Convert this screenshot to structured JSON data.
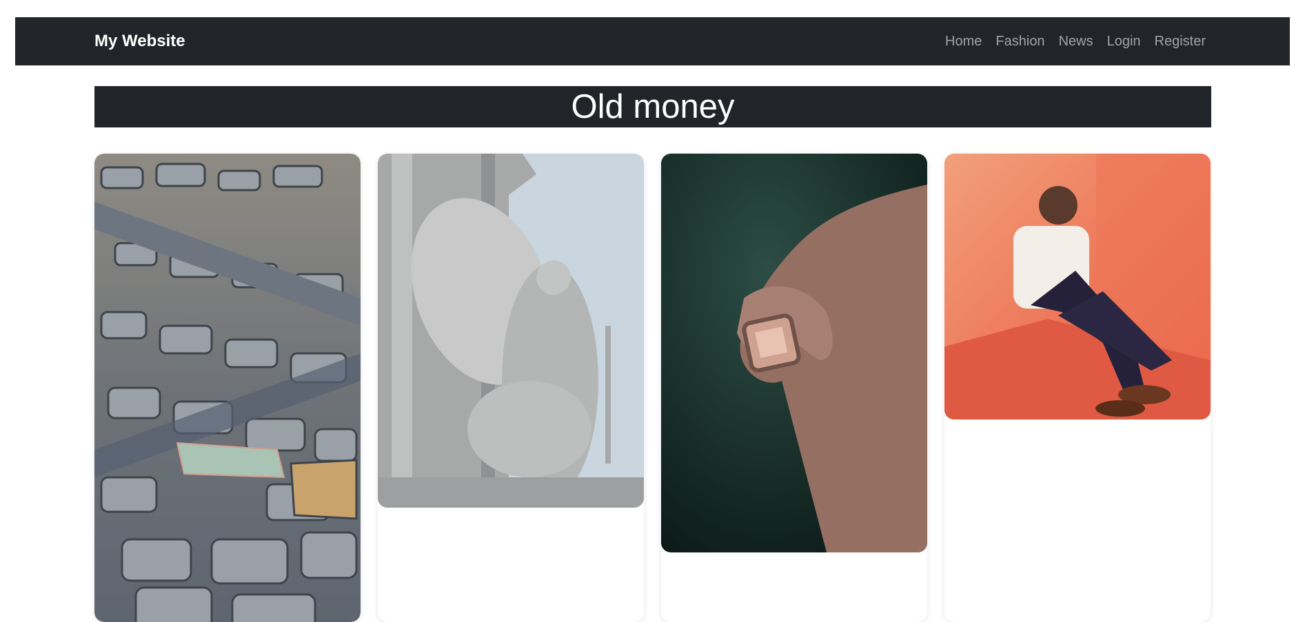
{
  "navbar": {
    "brand": "My Website",
    "links": [
      "Home",
      "Fashion",
      "News",
      "Login",
      "Register"
    ]
  },
  "banner": {
    "title": "Old money"
  },
  "colors": {
    "navbar_bg": "#212529",
    "nav_link": "#a0a3a6",
    "brand_text": "#ffffff"
  }
}
